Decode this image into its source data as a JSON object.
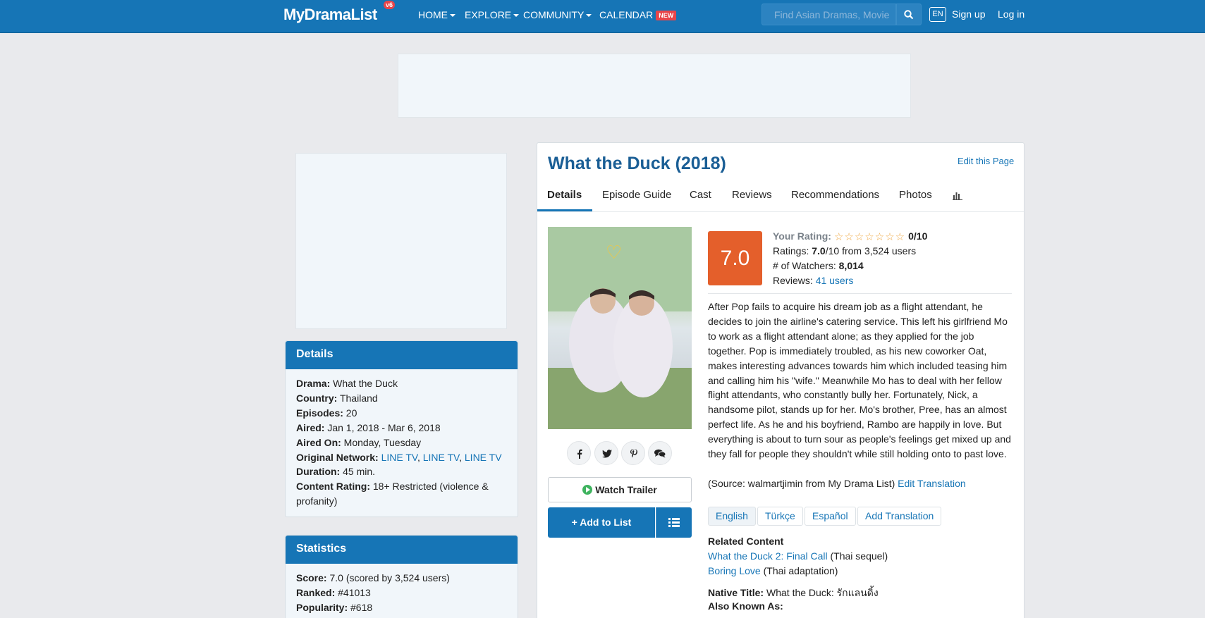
{
  "nav": {
    "logo": "MyDramaList",
    "version_badge": "v6",
    "items": [
      {
        "label": "HOME"
      },
      {
        "label": "EXPLORE"
      },
      {
        "label": "COMMUNITY"
      },
      {
        "label": "CALENDAR",
        "badge": "NEW"
      }
    ],
    "search_placeholder": "Find Asian Dramas, Movie",
    "lang": "EN",
    "signup": "Sign up",
    "login": "Log in"
  },
  "title": "What the Duck (2018)",
  "edit_page": "Edit this Page",
  "tabs": [
    "Details",
    "Episode Guide",
    "Cast",
    "Reviews",
    "Recommendations",
    "Photos"
  ],
  "tab_stats_icon": "bar-chart-icon",
  "score": "7.0",
  "ratings": {
    "your_label": "Your Rating:",
    "your_value": "0/10",
    "ratings_label": "Ratings:",
    "ratings_value": "7.0",
    "ratings_rest": "/10 from 3,524 users",
    "watchers_label": "# of Watchers:",
    "watchers_value": "8,014",
    "reviews_label": "Reviews:",
    "reviews_value": "41 users"
  },
  "synopsis": "After Pop fails to acquire his dream job as a flight attendant, he decides to join the airline's catering service. This left his girlfriend Mo to work as a flight attendant alone; as they applied for the job together. Pop is immediately troubled, as his new coworker Oat, makes interesting advances towards him which included teasing him and calling him his \"wife.\"  Meanwhile Mo has to deal with her fellow flight attendants, who constantly bully her. Fortunately, Nick, a handsome pilot, stands up for her. Mo's brother, Pree, has an almost perfect life. As he and his boyfriend, Rambo are happily in love. But everything is about to turn sour as people's feelings get mixed up and they fall for people they shouldn't while still holding onto to past love.",
  "source_text": "(Source: walmartjimin from My Drama List)",
  "edit_translation": "Edit Translation",
  "translations": [
    "English",
    "Türkçe",
    "Español",
    "Add Translation"
  ],
  "related": {
    "heading": "Related Content",
    "items": [
      {
        "title": "What the Duck 2: Final Call",
        "note": "(Thai sequel)"
      },
      {
        "title": "Boring Love",
        "note": "(Thai adaptation)"
      }
    ],
    "native_label": "Native Title:",
    "native_value": "What the Duck: รักแลนดิ้ง",
    "aka_label": "Also Known As:"
  },
  "watch_trailer": "Watch Trailer",
  "add_to_list": "+ Add to List",
  "details": {
    "heading": "Details",
    "drama_label": "Drama:",
    "drama": "What the Duck",
    "country_label": "Country:",
    "country": "Thailand",
    "episodes_label": "Episodes:",
    "episodes": "20",
    "aired_label": "Aired:",
    "aired": "Jan 1, 2018 - Mar 6, 2018",
    "aired_on_label": "Aired On:",
    "aired_on": "Monday, Tuesday",
    "network_label": "Original Network:",
    "networks": [
      "LINE TV",
      "LINE TV",
      "LINE TV"
    ],
    "duration_label": "Duration:",
    "duration": "45 min.",
    "rating_label": "Content Rating:",
    "rating": "18+ Restricted (violence & profanity)"
  },
  "statistics": {
    "heading": "Statistics",
    "score_label": "Score:",
    "score": "7.0 (scored by 3,524 users)",
    "ranked_label": "Ranked:",
    "ranked": "#41013",
    "popularity_label": "Popularity:",
    "popularity": "#618"
  },
  "colors": {
    "brand": "#1675b6",
    "score": "#e45f2b",
    "link": "#1675b6"
  }
}
